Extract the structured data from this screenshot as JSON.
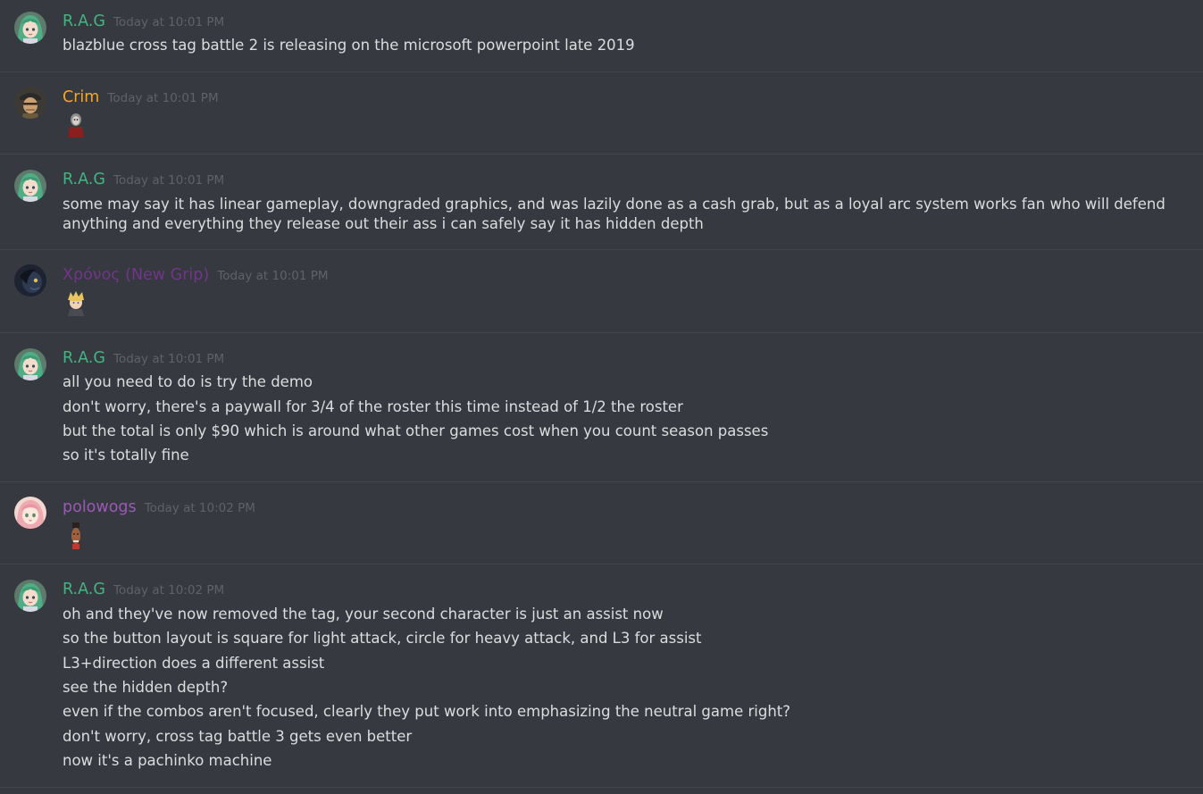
{
  "colors": {
    "background": "#36393f",
    "divider": "#42454a",
    "text": "#dcddde",
    "timestamp": "#5f6267",
    "rag": "#43b581",
    "crim": "#faa61a",
    "chronos": "#71368a",
    "polowogs": "#9b59b6"
  },
  "messages": [
    {
      "author": "R.A.G",
      "timestamp": "Today at 10:01 PM",
      "avatar_icon": "anime-girl-green-hair-avatar",
      "lines": [
        "blazblue cross tag battle 2 is releasing on the microsoft powerpoint late 2019"
      ]
    },
    {
      "author": "Crim",
      "timestamp": "Today at 10:01 PM",
      "avatar_icon": "jojo-character-avatar",
      "emoji_icon": "custom-face-emoji"
    },
    {
      "author": "R.A.G",
      "timestamp": "Today at 10:01 PM",
      "avatar_icon": "anime-girl-green-hair-avatar",
      "lines": [
        "some may say it has linear gameplay, downgraded graphics, and was lazily done as a cash grab, but as a loyal arc system works fan who will defend anything and everything they release out their ass i can safely say it has hidden depth"
      ]
    },
    {
      "author": "Χρόνος (New Grip)",
      "timestamp": "Today at 10:01 PM",
      "avatar_icon": "dark-character-avatar",
      "emoji_icon": "blonde-character-emoji"
    },
    {
      "author": "R.A.G",
      "timestamp": "Today at 10:01 PM",
      "avatar_icon": "anime-girl-green-hair-avatar",
      "lines": [
        "all you need to do is try the demo",
        "don't worry, there's a paywall for 3/4 of the roster this time instead of 1/2 the roster",
        "but the total is only $90 which is around what other games cost when you count season passes",
        "so it's totally fine"
      ]
    },
    {
      "author": "polowogs",
      "timestamp": "Today at 10:02 PM",
      "avatar_icon": "pink-hair-girl-avatar",
      "emoji_icon": "tall-face-emoji"
    },
    {
      "author": "R.A.G",
      "timestamp": "Today at 10:02 PM",
      "avatar_icon": "anime-girl-green-hair-avatar",
      "lines": [
        "oh and they've now removed the tag, your second character is just an assist now",
        "so the button layout is square for light attack, circle for heavy attack, and L3 for assist",
        "L3+direction does a different assist",
        "see the hidden depth?",
        "even if the combos aren't focused, clearly they put work into emphasizing the neutral game right?",
        "don't worry, cross tag battle 3 gets even better",
        "now it's a pachinko machine"
      ]
    }
  ]
}
